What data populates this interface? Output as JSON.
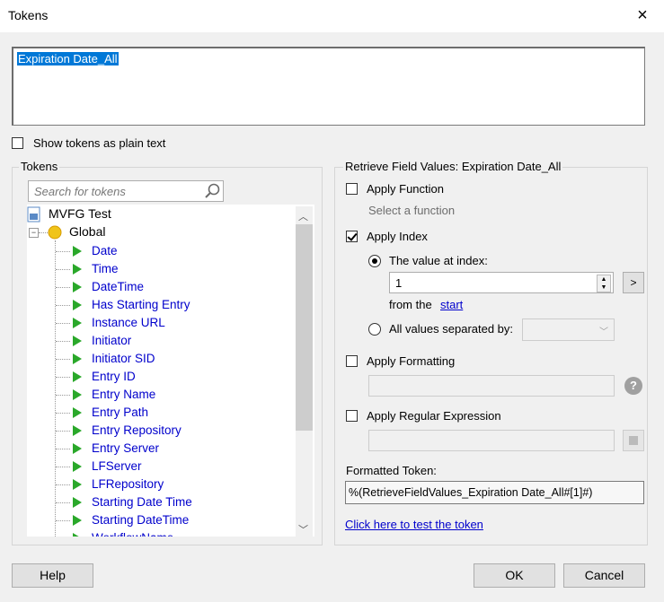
{
  "window": {
    "title": "Tokens",
    "close": "×"
  },
  "token_text": "Expiration Date_All",
  "show_plain_label": "Show tokens as plain text",
  "tokens_panel": {
    "legend": "Tokens",
    "search_placeholder": "Search for tokens",
    "root": "MVFG Test",
    "global": "Global",
    "items": [
      "Date",
      "Time",
      "DateTime",
      "Has Starting Entry",
      "Instance URL",
      "Initiator",
      "Initiator SID",
      "Entry ID",
      "Entry Name",
      "Entry Path",
      "Entry Repository",
      "Entry Server",
      "LFServer",
      "LFRepository",
      "Starting Date Time",
      "Starting DateTime",
      "WorkflowName"
    ]
  },
  "retrieve_panel": {
    "legend": "Retrieve Field Values: Expiration Date_All",
    "apply_function": "Apply Function",
    "select_function": "Select a function",
    "apply_index": "Apply Index",
    "value_at_index": "The value at index:",
    "index_value": "1",
    "from_the": "from the",
    "start": "start",
    "arrow": ">",
    "all_values": "All values separated by:",
    "apply_formatting": "Apply Formatting",
    "apply_regex": "Apply Regular Expression",
    "formatted_token_label": "Formatted Token:",
    "formatted_token": "%(RetrieveFieldValues_Expiration Date_All#[1]#)",
    "test_link": "Click here to test the token"
  },
  "buttons": {
    "help": "Help",
    "ok": "OK",
    "cancel": "Cancel"
  },
  "colors": {
    "link": "#0000cc",
    "selection": "#0078d7",
    "play": "#2aa82a"
  }
}
